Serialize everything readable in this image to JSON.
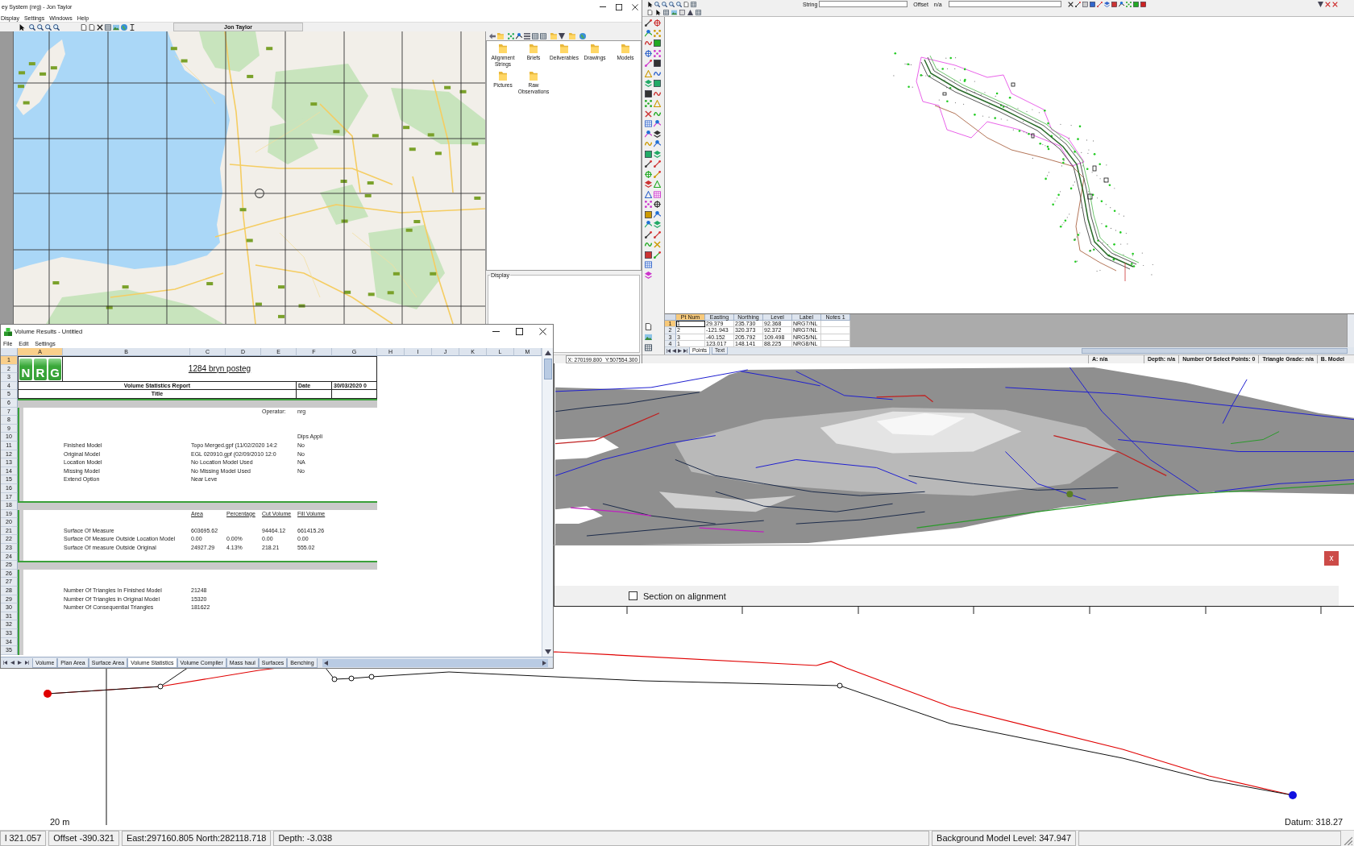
{
  "map_window": {
    "title": "ey System (nrg) - Jon Taylor",
    "menu": [
      "Display",
      "Settings",
      "Windows",
      "Help"
    ],
    "toolbar_label": "Jon Taylor",
    "folders": [
      {
        "name": "Alignment Strings"
      },
      {
        "name": "Briefs"
      },
      {
        "name": "Deliverables"
      },
      {
        "name": "Drawings"
      },
      {
        "name": "Models"
      },
      {
        "name": "Pictures"
      },
      {
        "name": "Raw Observations"
      }
    ],
    "display_group": "Display",
    "coordinates": {
      "x": "X: 270199.800",
      "y": "Y:507554.300"
    }
  },
  "plan_window": {
    "toolbar": {
      "string_label": "String",
      "offset_label": "Offset",
      "offset_value": "n/a"
    },
    "grid": {
      "columns": [
        {
          "label": "Pt Num",
          "selected": true
        },
        {
          "label": "Easting",
          "selected": false
        },
        {
          "label": "Northing",
          "selected": false
        },
        {
          "label": "Level",
          "selected": false
        },
        {
          "label": "Label",
          "selected": false
        },
        {
          "label": "Notes 1",
          "selected": false
        }
      ],
      "rows": [
        {
          "number": "1",
          "selected": true,
          "cells": [
            "1",
            "29.379",
            "235.730",
            "92.368",
            "NRG7/NL"
          ]
        },
        {
          "number": "2",
          "selected": false,
          "cells": [
            "2",
            "-121.943",
            "320.373",
            "92.372",
            "NRG7/NL"
          ]
        },
        {
          "number": "3",
          "selected": false,
          "cells": [
            "3",
            "-40.152",
            "205.792",
            "109.498",
            "NRG5/NL"
          ]
        },
        {
          "number": "4",
          "selected": false,
          "cells": [
            "1",
            "123.017",
            "148.141",
            "88.225",
            "NRG8/NL"
          ]
        }
      ],
      "tabs": [
        {
          "label": "Points",
          "selected": true
        },
        {
          "label": "Text",
          "selected": false
        }
      ]
    },
    "status": [
      "A: n/a",
      "Depth: n/a",
      "Number Of Select Points: 0",
      "Triangle Grade: n/a",
      "B. Model"
    ]
  },
  "volume_window": {
    "title": "Volume Results - Untitled",
    "menu": [
      "File",
      "Edit",
      "Settings"
    ],
    "sheet": {
      "columns": [
        {
          "label": "A",
          "selected": true
        },
        {
          "label": "B",
          "selected": false
        },
        {
          "label": "C",
          "selected": false
        },
        {
          "label": "D",
          "selected": false
        },
        {
          "label": "E",
          "selected": false
        },
        {
          "label": "F",
          "selected": false
        },
        {
          "label": "G",
          "selected": false
        },
        {
          "label": "H",
          "selected": false
        },
        {
          "label": "I",
          "selected": false
        },
        {
          "label": "J",
          "selected": false
        },
        {
          "label": "K",
          "selected": false
        },
        {
          "label": "L",
          "selected": false
        },
        {
          "label": "M",
          "selected": false
        }
      ],
      "row_numbers": [
        {
          "label": "1",
          "selected": true
        },
        {
          "label": "2",
          "selected": false
        },
        {
          "label": "3",
          "selected": false
        },
        {
          "label": "4",
          "selected": false
        },
        {
          "label": "5",
          "selected": false
        },
        {
          "label": "6",
          "selected": false
        },
        {
          "label": "7",
          "selected": false
        },
        {
          "label": "8",
          "selected": false
        },
        {
          "label": "9",
          "selected": false
        },
        {
          "label": "10",
          "selected": false
        },
        {
          "label": "11",
          "selected": false
        },
        {
          "label": "12",
          "selected": false
        },
        {
          "label": "13",
          "selected": false
        },
        {
          "label": "14",
          "selected": false
        },
        {
          "label": "15",
          "selected": false
        },
        {
          "label": "16",
          "selected": false
        },
        {
          "label": "17",
          "selected": false
        },
        {
          "label": "18",
          "selected": false
        },
        {
          "label": "19",
          "selected": false
        },
        {
          "label": "20",
          "selected": false
        },
        {
          "label": "21",
          "selected": false
        },
        {
          "label": "22",
          "selected": false
        },
        {
          "label": "23",
          "selected": false
        },
        {
          "label": "24",
          "selected": false
        },
        {
          "label": "25",
          "selected": false
        },
        {
          "label": "26",
          "selected": false
        },
        {
          "label": "27",
          "selected": false
        },
        {
          "label": "28",
          "selected": false
        },
        {
          "label": "29",
          "selected": false
        },
        {
          "label": "30",
          "selected": false
        },
        {
          "label": "31",
          "selected": false
        },
        {
          "label": "32",
          "selected": false
        },
        {
          "label": "33",
          "selected": false
        },
        {
          "label": "34",
          "selected": false
        },
        {
          "label": "35",
          "selected": false
        }
      ],
      "logo": [
        "N",
        "R",
        "G"
      ],
      "project_title": "1284 bryn posteg",
      "report_title": "Volume Statistics Report",
      "date_label": "Date",
      "date_value": "30/03/2020 0",
      "subtitle": "Title",
      "body_rows": [
        {
          "kind": "band"
        },
        {
          "kind": "data",
          "cells": {
            "e": "Operator:",
            "f": "nrg"
          }
        },
        {
          "kind": "data"
        },
        {
          "kind": "data"
        },
        {
          "kind": "data",
          "cells": {
            "f": "Dips Appli"
          }
        },
        {
          "kind": "data",
          "cells": {
            "b": "Finished Model",
            "c": "Topo Merged.gpf (11/02/2020 14:2",
            "f": "No"
          }
        },
        {
          "kind": "data",
          "cells": {
            "b": "Original Model",
            "c": "EGL 020910.gpf (02/09/2010 12:0",
            "f": "No"
          }
        },
        {
          "kind": "data",
          "cells": {
            "b": "Location Model",
            "c": "No Location Model Used",
            "f": "NA"
          }
        },
        {
          "kind": "data",
          "cells": {
            "b": "Missing Model",
            "c": "No Missing Model Used",
            "f": "No"
          }
        },
        {
          "kind": "data",
          "cells": {
            "b": "Extend Option",
            "c": "Near Leve"
          }
        },
        {
          "kind": "data"
        },
        {
          "kind": "data"
        },
        {
          "kind": "band"
        },
        {
          "kind": "header",
          "cells": {
            "c": "Area",
            "d": "Percentage",
            "e": "Cut Volume",
            "f": "Fill Volume"
          }
        },
        {
          "kind": "data"
        },
        {
          "kind": "data",
          "cells": {
            "b": "Surface Of Measure",
            "c": "603695.62",
            "e": "94464.12",
            "f": "661415.26"
          }
        },
        {
          "kind": "data",
          "cells": {
            "b": "Surface Of Measure Outside Location Model",
            "c": "0.00",
            "d": "0.00%",
            "e": "0.00",
            "f": "0.00"
          }
        },
        {
          "kind": "data",
          "cells": {
            "b": "Surface Of measure Outside Original",
            "c": "24927.29",
            "d": "4.13%",
            "e": "218.21",
            "f": "555.02"
          }
        },
        {
          "kind": "data"
        },
        {
          "kind": "band"
        },
        {
          "kind": "data"
        },
        {
          "kind": "data"
        },
        {
          "kind": "data",
          "cells": {
            "b": "Number Of Triangles In Finished Model",
            "c": "21248"
          }
        },
        {
          "kind": "data",
          "cells": {
            "b": "Number Of Triangles in Original Model",
            "c": "15320"
          }
        },
        {
          "kind": "data",
          "cells": {
            "b": "Number Of Consequential Triangles",
            "c": "181622"
          }
        },
        {
          "kind": "data"
        },
        {
          "kind": "data"
        },
        {
          "kind": "data"
        },
        {
          "kind": "data"
        },
        {
          "kind": "data"
        }
      ]
    },
    "sheet_tabs": [
      {
        "label": "Volume",
        "selected": false
      },
      {
        "label": "Plan Area",
        "selected": false
      },
      {
        "label": "Surface Area",
        "selected": false
      },
      {
        "label": "Volume Statistics",
        "selected": true
      },
      {
        "label": "Volume Compiler",
        "selected": false
      },
      {
        "label": "Mass haul",
        "selected": false
      },
      {
        "label": "Surfaces",
        "selected": false
      },
      {
        "label": "Benching",
        "selected": false
      }
    ]
  },
  "section_window": {
    "close_label": "x",
    "checkbox": {
      "label": "Section on alignment",
      "checked": false
    },
    "scale_label": "20 m",
    "datum_label": "Datum: 318.27"
  },
  "status_bar": [
    {
      "text": "l 321.057",
      "kind": "fixed"
    },
    {
      "text": "Offset -390.321",
      "kind": "fixed"
    },
    {
      "text": "East:297160.805 North:282118.718",
      "kind": "fixed"
    },
    {
      "text": "Depth: -3.038",
      "kind": "fill"
    },
    {
      "text": "Background Model Level: 347.947",
      "kind": "fixed"
    }
  ]
}
